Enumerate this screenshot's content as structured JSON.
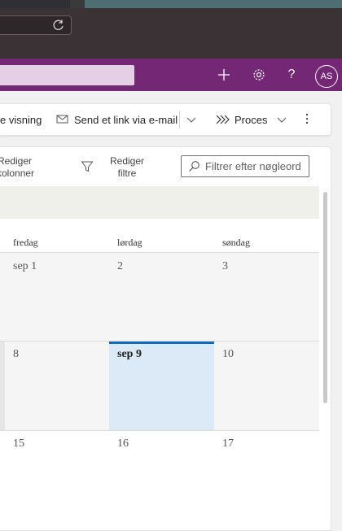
{
  "browser": {
    "reload_icon": "reload-icon"
  },
  "header": {
    "add_icon": "plus-icon",
    "settings_icon": "gear-icon",
    "help_label": "?",
    "avatar_initials": "AS"
  },
  "commandbar": {
    "view_label": "e visning",
    "send_link_label": "Send et link via e-mail",
    "process_label": "Proces"
  },
  "toolbar": {
    "edit_columns": [
      "Rediger",
      "kolonner"
    ],
    "edit_filters": [
      "Rediger",
      "filtre"
    ],
    "filter_placeholder": "Filtrer efter nøgleord"
  },
  "calendar": {
    "day_names": [
      "fredag",
      "lørdag",
      "søndag"
    ],
    "weeks": [
      [
        "sep 1",
        "2",
        "3"
      ],
      [
        "8",
        "sep 9",
        "10"
      ],
      [
        "15",
        "16",
        "17"
      ]
    ],
    "today_label": "sep 9"
  },
  "colors": {
    "app_bar": "#742774",
    "browser_bar": "#3b3236",
    "today_highlight": "#dce9f6",
    "today_accent": "#0f6cbd"
  }
}
